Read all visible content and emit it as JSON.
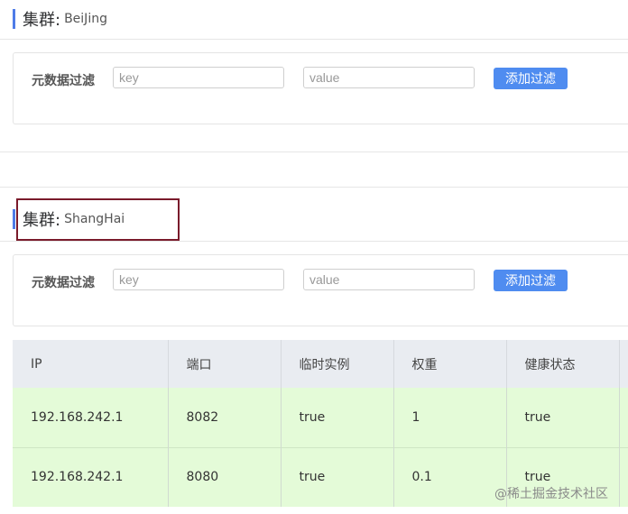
{
  "clusters": [
    {
      "label": "集群:",
      "name": "BeiJing",
      "filter": {
        "label": "元数据过滤",
        "key_placeholder": "key",
        "value_placeholder": "value",
        "button_label": "添加过滤"
      }
    },
    {
      "label": "集群:",
      "name": "ShangHai",
      "filter": {
        "label": "元数据过滤",
        "key_placeholder": "key",
        "value_placeholder": "value",
        "button_label": "添加过滤"
      }
    }
  ],
  "table": {
    "headers": [
      "IP",
      "端口",
      "临时实例",
      "权重",
      "健康状态"
    ],
    "rows": [
      [
        "192.168.242.1",
        "8082",
        "true",
        "1",
        "true"
      ],
      [
        "192.168.242.1",
        "8080",
        "true",
        "0.1",
        "true"
      ]
    ]
  },
  "colors": {
    "accent": "#4f7ce8",
    "button": "#4f8cf0",
    "row_background": "#e4fbd8",
    "header_background": "#e9ecf1",
    "highlight_border": "#7a1b2b"
  },
  "watermark": "@稀土掘金技术社区"
}
